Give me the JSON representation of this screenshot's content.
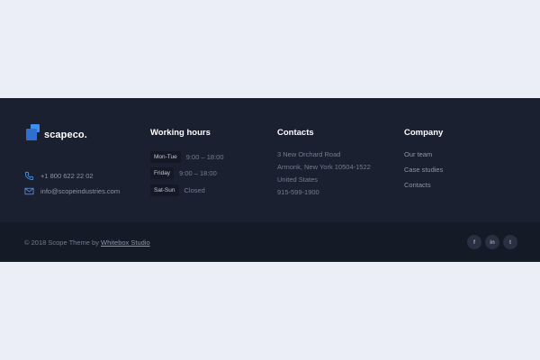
{
  "brand": {
    "name": "scapeco.",
    "logo_icon": "stacked-squares-logo"
  },
  "contact": {
    "phone": "+1 800 622 22 02",
    "email": "info@scopeindustries.com",
    "phone_icon": "phone-icon",
    "email_icon": "envelope-icon"
  },
  "working_hours": {
    "title": "Working hours",
    "rows": [
      {
        "day": "Mon-Tue",
        "time": "9:00 – 18:00"
      },
      {
        "day": "Friday",
        "time": "9:00 – 18:00"
      },
      {
        "day": "Sat-Sun",
        "time": "Closed"
      }
    ]
  },
  "contacts": {
    "title": "Contacts",
    "lines": [
      "3 New Orchard Road",
      "Armonk, New York 10504-1522",
      "United States",
      "915-599-1900"
    ]
  },
  "company": {
    "title": "Company",
    "links": [
      "Our team",
      "Case studies",
      "Contacts"
    ]
  },
  "bottom": {
    "copyright_prefix": "© 2018 Scope Theme by ",
    "copyright_link": "Whitebox Studio",
    "social": [
      {
        "icon": "facebook-icon",
        "glyph": "f"
      },
      {
        "icon": "linkedin-icon",
        "glyph": "in"
      },
      {
        "icon": "twitter-icon",
        "glyph": "t"
      }
    ]
  },
  "colors": {
    "page_bg": "#ebeef7",
    "footer_bg": "#1b2030",
    "footer_bottom_bg": "#151a27",
    "accent": "#3f8ef0"
  }
}
